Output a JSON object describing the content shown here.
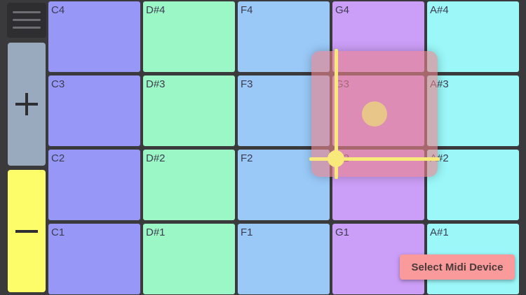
{
  "colors": {
    "c_column": "#9797f8",
    "dsharp_column": "#9cf7c6",
    "f_column": "#9ac9f8",
    "g_column": "#cb9ef7",
    "asharp_column": "#9bf7f8"
  },
  "sidebar": {
    "menu_icon": "hamburger-icon",
    "plus_icon": "plus-icon",
    "minus_icon": "minus-icon"
  },
  "pads": [
    {
      "label": "C4",
      "color": "#9797f8"
    },
    {
      "label": "D#4",
      "color": "#9cf7c6"
    },
    {
      "label": "F4",
      "color": "#9ac9f8"
    },
    {
      "label": "G4",
      "color": "#cb9ef7"
    },
    {
      "label": "A#4",
      "color": "#9bf7f8"
    },
    {
      "label": "C3",
      "color": "#9797f8"
    },
    {
      "label": "D#3",
      "color": "#9cf7c6"
    },
    {
      "label": "F3",
      "color": "#9ac9f8"
    },
    {
      "label": "G3",
      "color": "#cb9ef7"
    },
    {
      "label": "A#3",
      "color": "#9bf7f8"
    },
    {
      "label": "C2",
      "color": "#9797f8"
    },
    {
      "label": "D#2",
      "color": "#9cf7c6"
    },
    {
      "label": "F2",
      "color": "#9ac9f8"
    },
    {
      "label": "G2",
      "color": "#cb9ef7"
    },
    {
      "label": "A#2",
      "color": "#9bf7f8"
    },
    {
      "label": "C1",
      "color": "#9797f8"
    },
    {
      "label": "D#1",
      "color": "#9cf7c6"
    },
    {
      "label": "F1",
      "color": "#9ac9f8"
    },
    {
      "label": "G1",
      "color": "#cb9ef7"
    },
    {
      "label": "A#1",
      "color": "#9bf7f8"
    }
  ],
  "midi_button": {
    "label": "Select Midi Device"
  }
}
